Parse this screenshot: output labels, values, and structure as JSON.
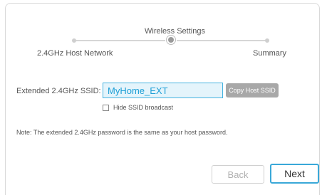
{
  "stepper": {
    "steps": [
      {
        "label": "2.4GHz Host Network",
        "state": "done"
      },
      {
        "label": "Wireless Settings",
        "state": "current"
      },
      {
        "label": "Summary",
        "state": "pending"
      }
    ]
  },
  "form": {
    "ssid_label": "Extended 2.4GHz SSID:",
    "ssid_value": "MyHome_EXT",
    "copy_button_label": "Copy Host SSID",
    "hide_ssid_label": "Hide SSID broadcast",
    "hide_ssid_checked": false,
    "note": "Note: The extended 2.4GHz password is the same as your host password."
  },
  "footer": {
    "back_label": "Back",
    "next_label": "Next"
  },
  "colors": {
    "accent": "#3aa8d8",
    "input_bg": "#e4f4fb",
    "input_text": "#1e9fd6",
    "disabled_button": "#a8a8a8"
  }
}
